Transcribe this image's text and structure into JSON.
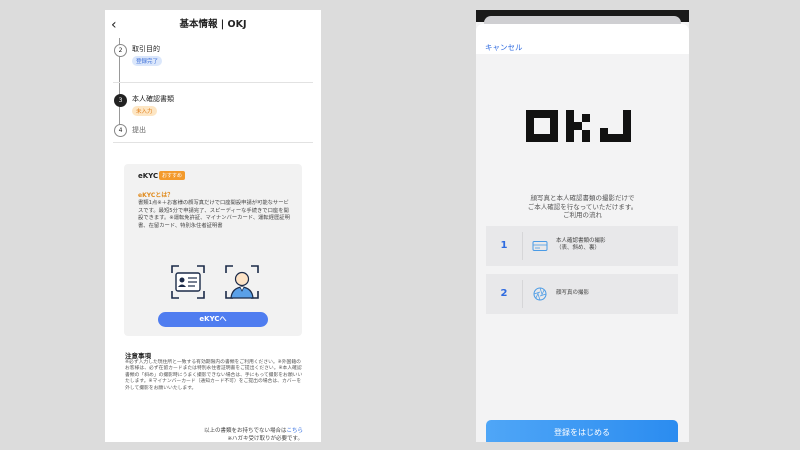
{
  "left": {
    "header": {
      "back_icon": "chevron-left-icon",
      "title": "基本情報 | OKJ"
    },
    "steps": [
      {
        "num": "2",
        "label": "取引目的",
        "badge": "登録完了"
      },
      {
        "num": "3",
        "label": "本人確認書類",
        "badge": "未入力"
      },
      {
        "num": "4",
        "label": "提出"
      }
    ],
    "ekyc_card": {
      "title": "eKYC",
      "recommend": "おすすめ",
      "question": "eKYCとは？",
      "desc": "書類1点※＋お客様の顔写真だけで口座開設申請が可能なサービスです。最短5分で申請完了、スピーディーな手続きで口座を開設できます。※運転免許証、マイナンバーカード、運転経歴証明書、在留カード、特別永住者証明書",
      "button": "eKYCへ"
    },
    "notes": {
      "title": "注意事項",
      "body": "※必ず入力した現住所と一致する有効期限内の書類をご利用ください。※外国籍のお客様は、必ず在留カードまたは特別永住者証明書をご提出ください。※本人確認書類の「斜め」の撮影時にうまく撮影できない場合は、手にもって撮影をお願いいたします。※マイナンバーカード（通知カード不可）をご提出の場合は、カバーを外して撮影をお願いいたします。"
    },
    "footer": {
      "text": "以上の書類をお持ちでない場合は",
      "link": "こちら",
      "note": "※ハガキ受け取りが必要です。"
    }
  },
  "right": {
    "cancel": "キャンセル",
    "logo_text": "OKJ",
    "intro_line1": "顔写真と本人確認書類の撮影だけで",
    "intro_line2": "ご本人確認を行なっていただけます。",
    "intro_line3": "ご利用の流れ",
    "steps": [
      {
        "num": "1",
        "line1": "本人確認書類の撮影",
        "line2": "（表、斜め、裏）",
        "icon": "id-card-icon"
      },
      {
        "num": "2",
        "line1": "顔写真の撮影",
        "icon": "camera-shutter-icon"
      }
    ],
    "start_button": "登録をはじめる"
  },
  "colors": {
    "accent": "#2f6be0",
    "orange": "#f39a2c",
    "button_blue": "#4f7df0"
  }
}
